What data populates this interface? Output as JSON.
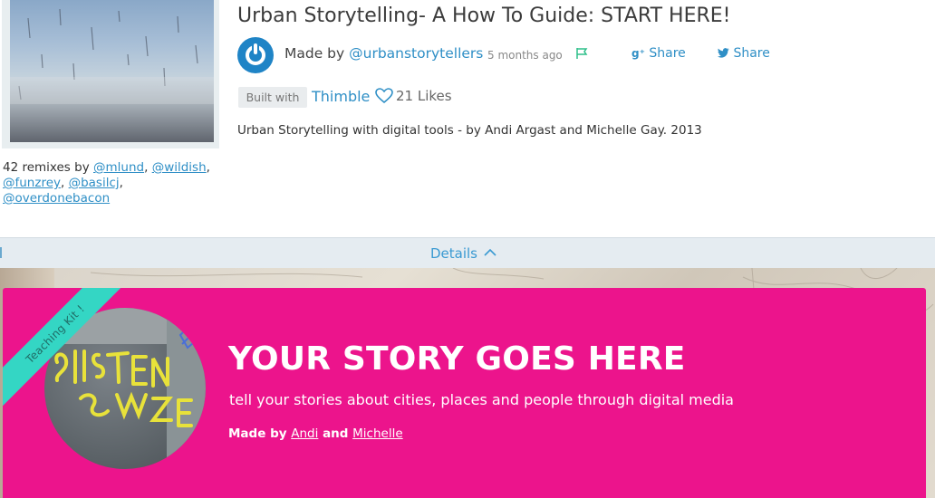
{
  "project": {
    "title": "Urban Storytelling- A How To Guide: START HERE!",
    "made_by_prefix": "Made by",
    "author": "@urbanstorytellers",
    "time_ago": "5 months ago",
    "share_google": "Share",
    "share_twitter": "Share",
    "built_with_label": "Built with",
    "tool": "Thimble",
    "likes": "21 Likes",
    "description": "Urban Storytelling with digital tools - by Andi Argast and Michelle Gay. 2013"
  },
  "remixes": {
    "prefix": "42 remixes by",
    "users": [
      "@mlund",
      "@wildish",
      "@funzrey",
      "@basilcj",
      "@overdonebacon"
    ]
  },
  "details": {
    "label": "Details"
  },
  "hero": {
    "ribbon": "Teaching Kit !",
    "title": "YOUR STORY GOES HERE",
    "subtitle": "tell your stories about cities, places and people through digital media",
    "made_by_prefix": "Made by",
    "author1": "Andi",
    "and": "and",
    "author2": "Michelle"
  },
  "icons": {
    "author_logo": "power-icon",
    "flag": "flag-icon",
    "google_plus": "google-plus-icon",
    "twitter": "twitter-icon",
    "heart": "heart-icon",
    "chevron": "chevron-up-icon"
  },
  "colors": {
    "link": "#2f8fc6",
    "hero_bg": "#ec148c",
    "ribbon": "#34d6c4",
    "details_bar": "#e5ecf1"
  }
}
